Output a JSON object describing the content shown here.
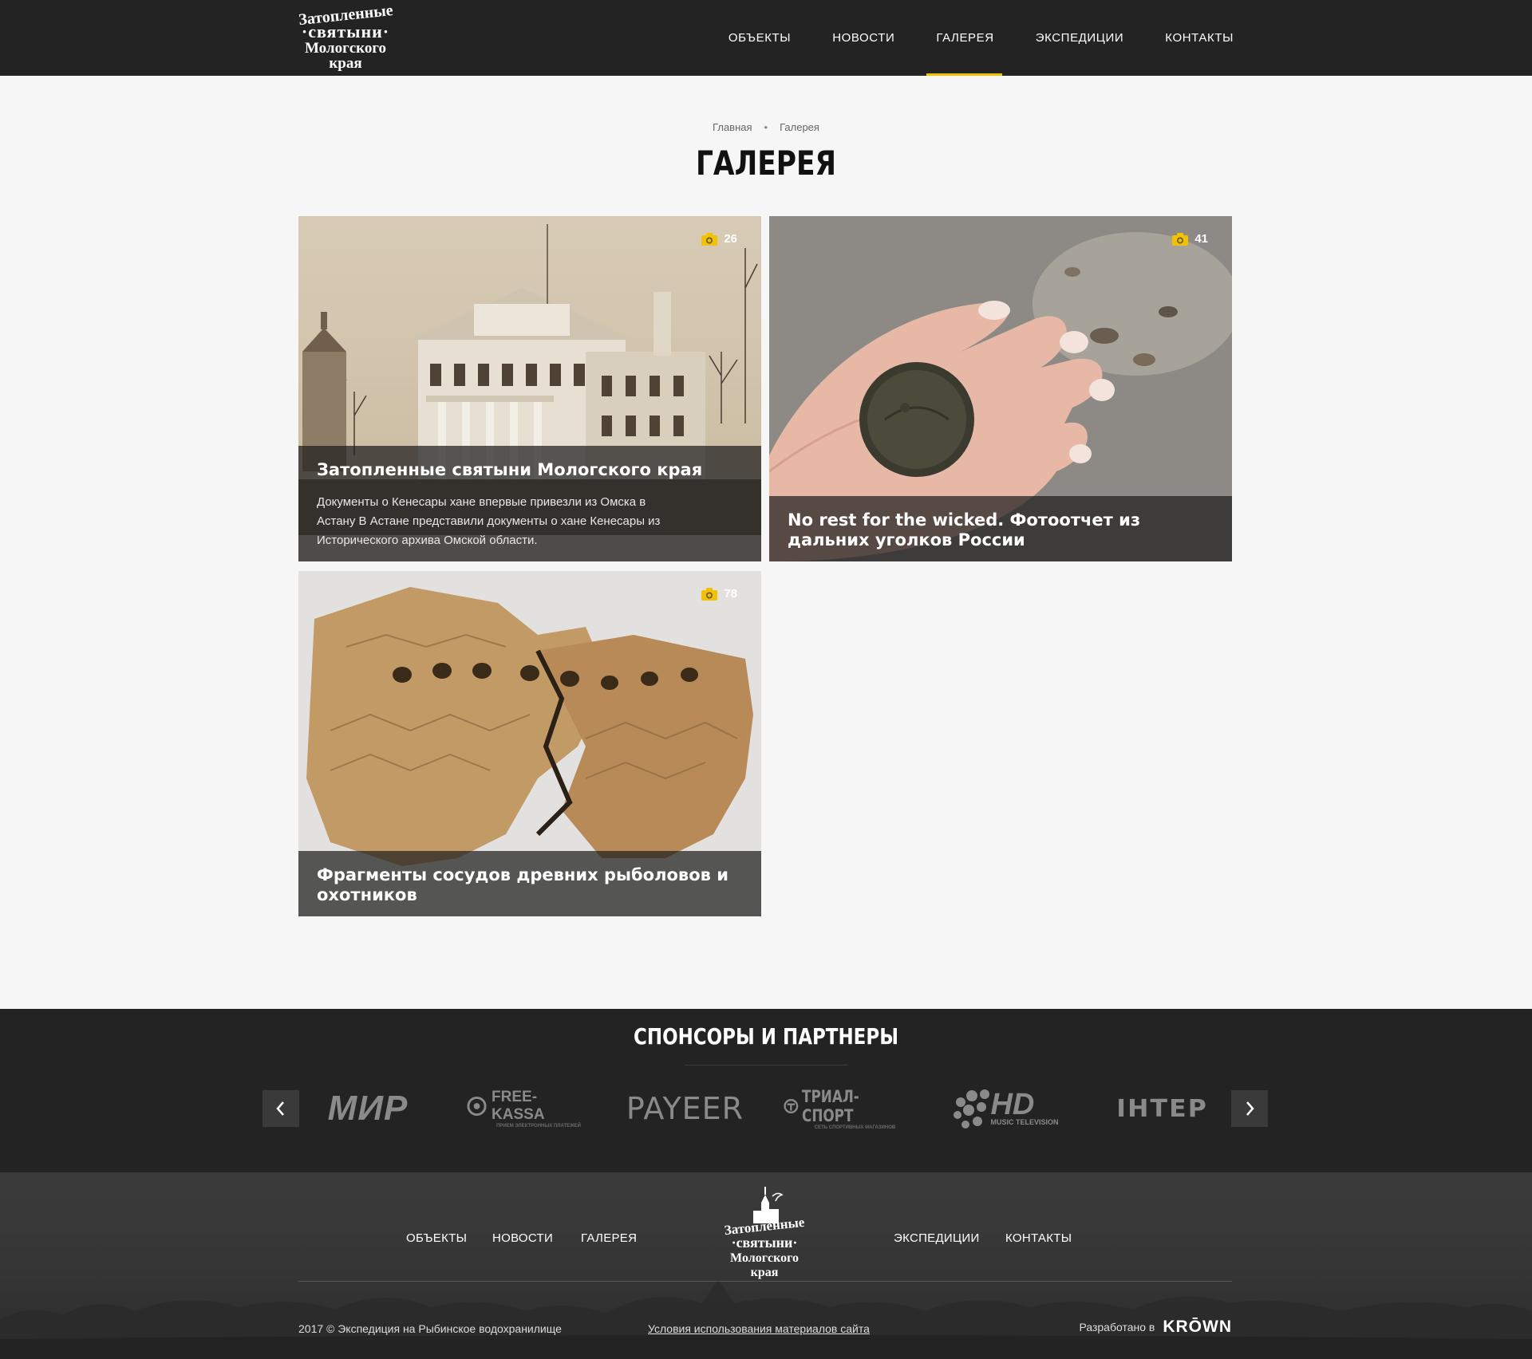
{
  "header": {
    "logo": {
      "line1": "Затопленные",
      "line2": "·святыни·",
      "line3": "Мологского края"
    },
    "nav": [
      "ОБЪЕКТЫ",
      "НОВОСТИ",
      "ГАЛЕРЕЯ",
      "ЭКСПЕДИЦИИ",
      "КОНТАКТЫ"
    ],
    "active_nav": "ГАЛЕРЕЯ"
  },
  "breadcrumb": {
    "home": "Главная",
    "separator": "•",
    "current": "Галерея"
  },
  "page_title": "ГАЛЕРЕЯ",
  "gallery": [
    {
      "title": "Затопленные святыни Мологского края",
      "count": "26",
      "description": "Документы о Кенесары хане впервые привезли из Омска в Астану В Астане представили документы о хане Кенесары из Исторического архива Омской области.",
      "image": "sepia-manor-house"
    },
    {
      "title": "No rest for the wicked. Фотоотчет из дальних уголков России",
      "count": "41",
      "description": "",
      "image": "coin-in-hand"
    },
    {
      "title": "Фрагменты сосудов древних рыболовов и охотников",
      "count": "78",
      "description": "",
      "image": "pottery-fragments"
    }
  ],
  "sponsors": {
    "title": "СПОНСОРЫ И ПАРТНЕРЫ",
    "logos": [
      "МИР",
      "FREE-KASSA",
      "PAYEER",
      "ТРИАЛ-СПОРТ",
      "HD",
      "ІНТЕР"
    ],
    "freekassa_sub": "ПРИЕМ ЭЛЕКТРОННЫХ ПЛАТЕЖЕЙ",
    "trial_sub": "СЕТЬ СПОРТИВНЫХ МАГАЗИНОВ",
    "hd_sub": "MUSIC TELEVISION"
  },
  "footer": {
    "nav_left": [
      "ОБЪЕКТЫ",
      "НОВОСТИ",
      "ГАЛЕРЕЯ"
    ],
    "nav_right": [
      "ЭКСПЕДИЦИИ",
      "КОНТАКТЫ"
    ],
    "logo": {
      "line1": "Затопленные",
      "line2": "·святыни·",
      "line3": "Мологского края"
    },
    "copyright": "2017 © Экспедиция на Рыбинское водохранилище",
    "terms": "Условия использования материалов сайта",
    "developed_by": "Разработано в",
    "developer": "KRŌWN"
  },
  "colors": {
    "accent": "#f2c100",
    "header_bg": "#232323",
    "page_bg": "#f6f6f6",
    "footer_bg": "#353535"
  }
}
